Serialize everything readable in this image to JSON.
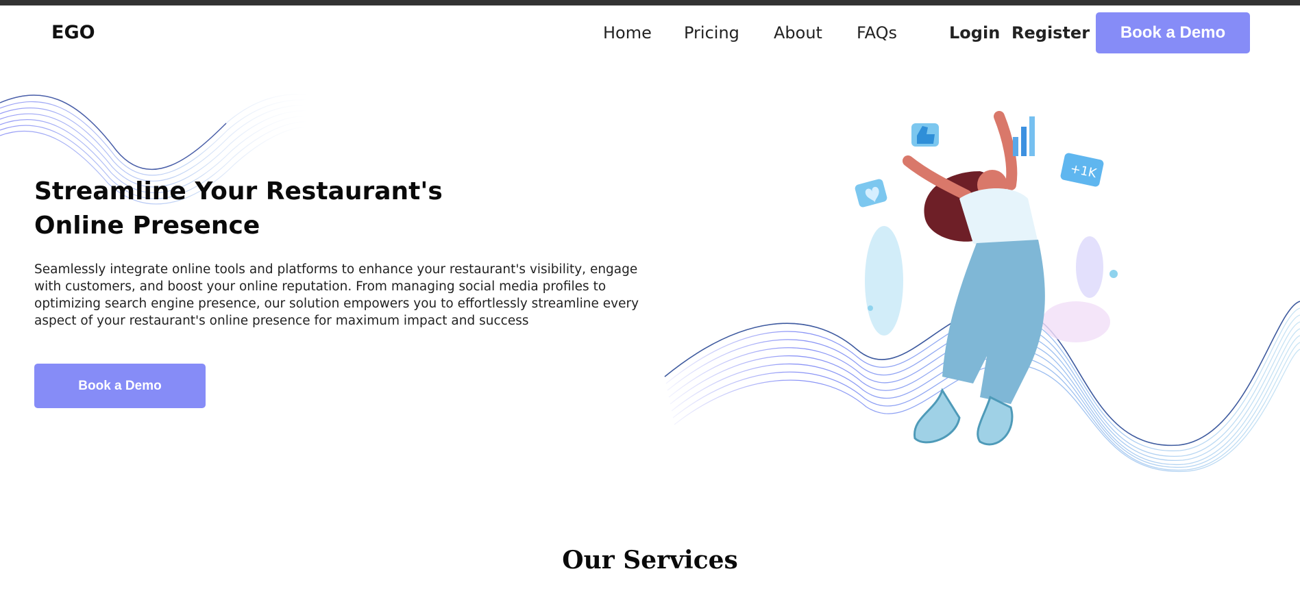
{
  "nav": {
    "logo": "EGO",
    "links": [
      "Home",
      "Pricing",
      "About",
      "FAQs"
    ],
    "login": "Login",
    "register": "Register",
    "cta": "Book a Demo"
  },
  "hero": {
    "title": "Streamline Your Restaurant's Online Presence",
    "description": "Seamlessly integrate online tools and platforms to enhance your restaurant's visibility, engage with customers, and boost your online reputation. From managing social media profiles to optimizing search engine presence, our solution empowers you to effortlessly streamline every aspect of your restaurant's online presence for maximum impact and success",
    "cta": "Book a Demo",
    "badge": "+1K"
  },
  "services": {
    "title": "Our Services"
  },
  "colors": {
    "accent": "#868cf7",
    "top_strip": "#333333"
  },
  "icons": [
    "thumbs-up-icon",
    "bar-chart-icon",
    "heart-icon",
    "plus-1k-badge-icon"
  ]
}
